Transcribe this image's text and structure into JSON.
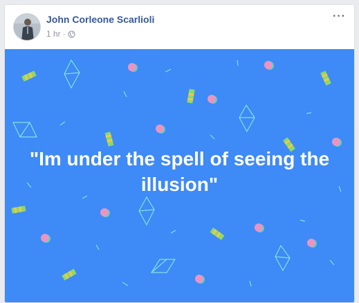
{
  "post": {
    "author": "John Corleone Scarlioli",
    "timestamp": "1 hr",
    "separator": "·",
    "privacy_icon": "globe-icon",
    "more_icon": "ellipsis-icon",
    "more_label": "···",
    "text": "\"Im under the spell of seeing the illusion\"",
    "background_color": "#3e8af6"
  }
}
